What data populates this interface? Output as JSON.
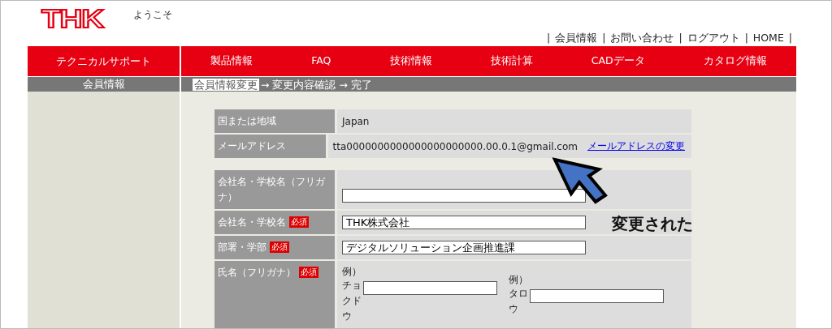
{
  "header": {
    "logo": "THK",
    "welcome": "ようこそ",
    "links": [
      "会員情報",
      "お問い合わせ",
      "ログアウト",
      "HOME"
    ],
    "link_separator": "|"
  },
  "nav": {
    "side_title": "テクニカルサポート",
    "items": [
      {
        "label": "製品情報"
      },
      {
        "label": "FAQ"
      },
      {
        "label": "技術情報"
      },
      {
        "label": "技術計算"
      },
      {
        "label": "CADデータ"
      },
      {
        "label": "カタログ情報"
      }
    ]
  },
  "subbar": {
    "side_title": "会員情報",
    "separator": "→",
    "steps": [
      {
        "label": "会員情報変更",
        "selected": true
      },
      {
        "label": "変更内容確認",
        "selected": false
      },
      {
        "label": "完了",
        "selected": false
      }
    ]
  },
  "form": {
    "groups": [
      {
        "rows": [
          {
            "kind": "text",
            "label": "国または地域",
            "value": "Japan"
          },
          {
            "kind": "email",
            "label": "メールアドレス",
            "value": "tta0000000000000000000000.00.0.1@gmail.com",
            "link": "メールアドレスの変更"
          }
        ]
      },
      {
        "rows": [
          {
            "kind": "input",
            "label": "会社名・学校名（フリガナ）"
          },
          {
            "kind": "input",
            "label": "会社名・学校名",
            "badge": "必須",
            "value": "THK株式会社"
          },
          {
            "kind": "input",
            "label": "部署・学部",
            "badge": "必須",
            "value": "デジタルソリューション企画推進課"
          },
          {
            "kind": "name",
            "label": "氏名（フリガナ）",
            "badge": "必須",
            "parts": [
              {
                "example": "例）",
                "hint": "チョクドウ"
              },
              {
                "example": "例）",
                "hint": "タロウ"
              }
            ]
          }
        ]
      }
    ]
  },
  "annotation": {
    "text": "変更された"
  }
}
